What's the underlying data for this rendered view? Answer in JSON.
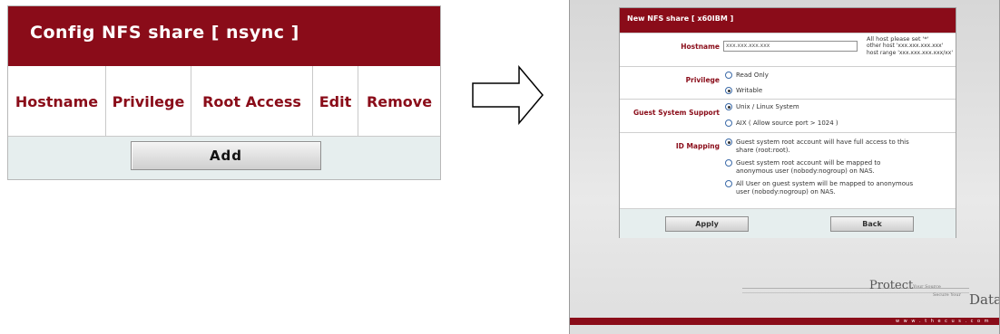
{
  "left": {
    "title": "Config NFS share [ nsync ]",
    "columns": [
      "Hostname",
      "Privilege",
      "Root Access",
      "Edit",
      "Remove"
    ],
    "add_label": "Add"
  },
  "arrow_icon": "right-arrow-outline-icon",
  "right": {
    "title": "New NFS share [ x60IBM ]",
    "hostname": {
      "label": "Hostname",
      "value": "xxx.xxx.xxx.xxx",
      "hint1": "All host please set '*'",
      "hint2": "other host 'xxx.xxx.xxx.xxx'",
      "hint3": "host range 'xxx.xxx.xxx.xxx/xx'"
    },
    "privilege": {
      "label": "Privilege",
      "options": [
        "Read Only",
        "Writable"
      ],
      "selected": "Writable"
    },
    "guest_system": {
      "label": "Guest System Support",
      "options": [
        "Unix / Linux System",
        "AIX ( Allow source port > 1024 )"
      ],
      "selected": "Unix / Linux System"
    },
    "id_mapping": {
      "label": "ID Mapping",
      "opt1_line1": "Guest system root account will have full access to this",
      "opt1_line2": "share (root:root).",
      "opt2_line1": "Guest system root account will be mapped to",
      "opt2_line2": "anonymous user (nobody:nogroup) on NAS.",
      "opt3_line1": "All User on guest system will be mapped to anonymous",
      "opt3_line2": "user (nobody:nogroup) on NAS.",
      "selected": 1
    },
    "apply_label": "Apply",
    "back_label": "Back",
    "brand": {
      "protect": "Protect",
      "your_source": "Your Source",
      "secure_your": "Secure Your",
      "data": "Data",
      "url": "w w w . t h e c u s . c o m"
    }
  },
  "colors": {
    "brand_red": "#8a0c19",
    "add_row_bg": "#e6eeee"
  }
}
